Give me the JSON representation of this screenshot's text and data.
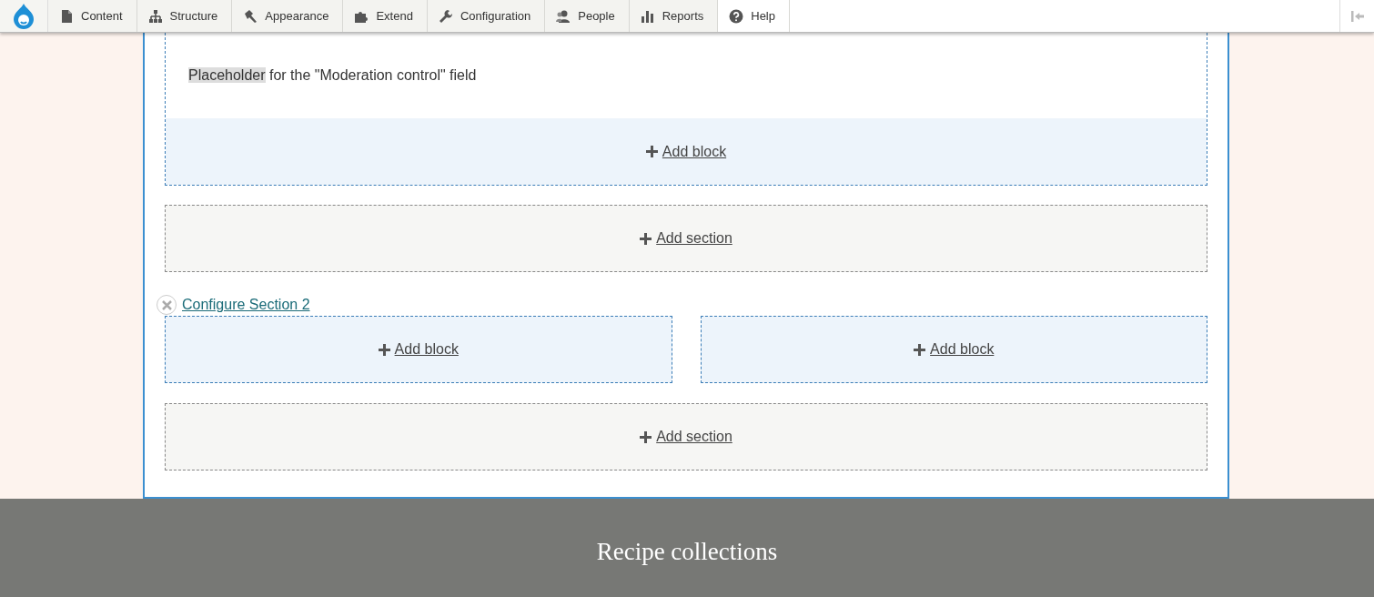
{
  "toolbar": {
    "items": [
      {
        "label": "Content"
      },
      {
        "label": "Structure"
      },
      {
        "label": "Appearance"
      },
      {
        "label": "Extend"
      },
      {
        "label": "Configuration"
      },
      {
        "label": "People"
      },
      {
        "label": "Reports"
      },
      {
        "label": "Help"
      }
    ]
  },
  "layout": [
    {
      "kind": "region",
      "field_note": {
        "highlight": "Placeholder",
        "text": "for the \"Moderation control\" field"
      },
      "link": "Add block"
    },
    {
      "kind": "add-section",
      "link": "Add section"
    },
    {
      "kind": "section",
      "configure": "Configure Section 2",
      "regions": [
        {
          "link": "Add block"
        },
        {
          "link": "Add block"
        }
      ]
    },
    {
      "kind": "add-section",
      "link": "Add section"
    }
  ],
  "footer": {
    "title": "Recipe collections"
  }
}
